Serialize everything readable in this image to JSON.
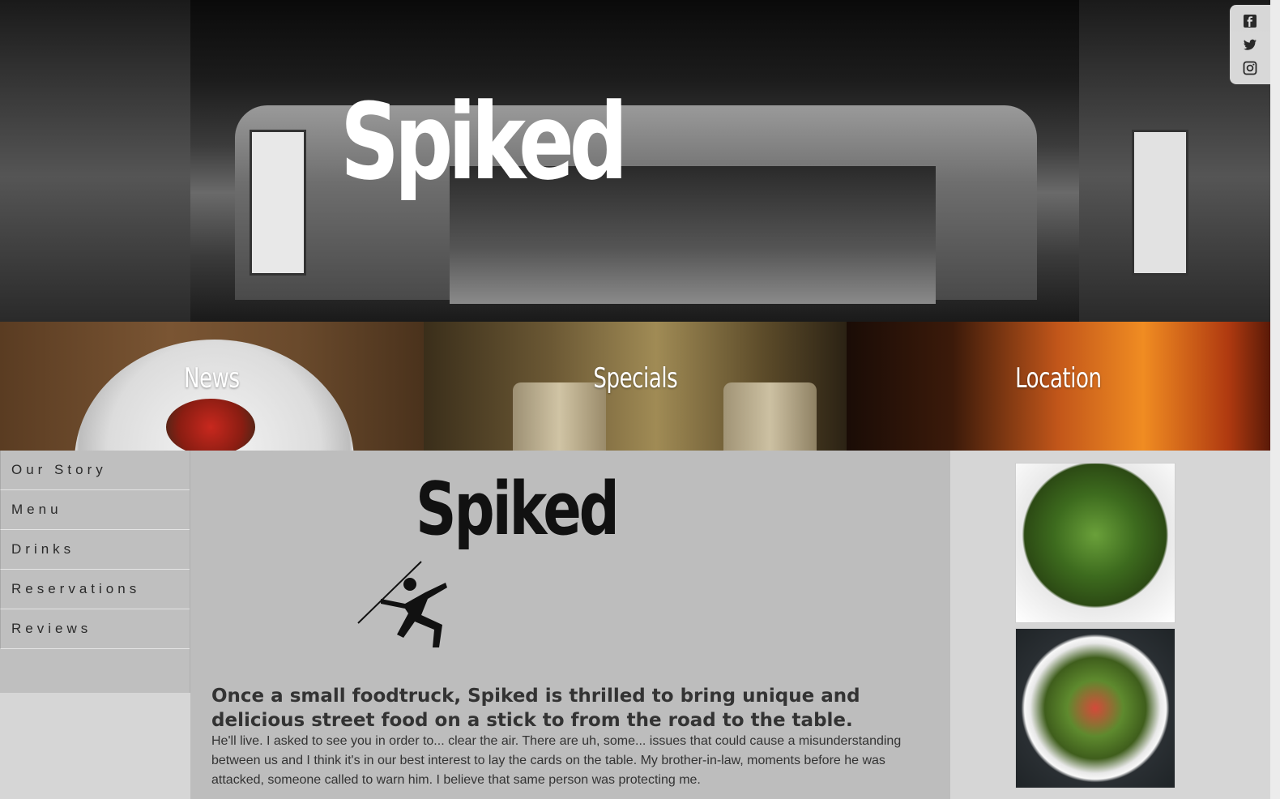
{
  "hero": {
    "title": "Spiked"
  },
  "social": {
    "icons": [
      "facebook-icon",
      "twitter-icon",
      "instagram-icon"
    ]
  },
  "tiles": [
    {
      "label": "News"
    },
    {
      "label": "Specials"
    },
    {
      "label": "Location"
    }
  ],
  "sidebar": {
    "items": [
      {
        "label": "Our Story"
      },
      {
        "label": "Menu"
      },
      {
        "label": "Drinks"
      },
      {
        "label": "Reservations"
      },
      {
        "label": "Reviews"
      }
    ]
  },
  "main": {
    "logo_text": "Spiked",
    "headline": "Once a small foodtruck, Spiked is thrilled to bring unique and delicious street food on a stick to from the road to the table.",
    "body": "He'll live. I asked to see you in order to... clear the air. There are uh, some... issues that could cause a misunderstanding between us and I think it's in our best interest to lay the cards on the table. My brother-in-law, moments before he was attacked, someone called to warn him. I believe that same person was protecting me."
  },
  "colors": {
    "hero_text": "#ffffff",
    "nav_bg": "#bfbfbf",
    "main_bg": "#bdbdbd",
    "page_bg": "#d6d6d6"
  }
}
